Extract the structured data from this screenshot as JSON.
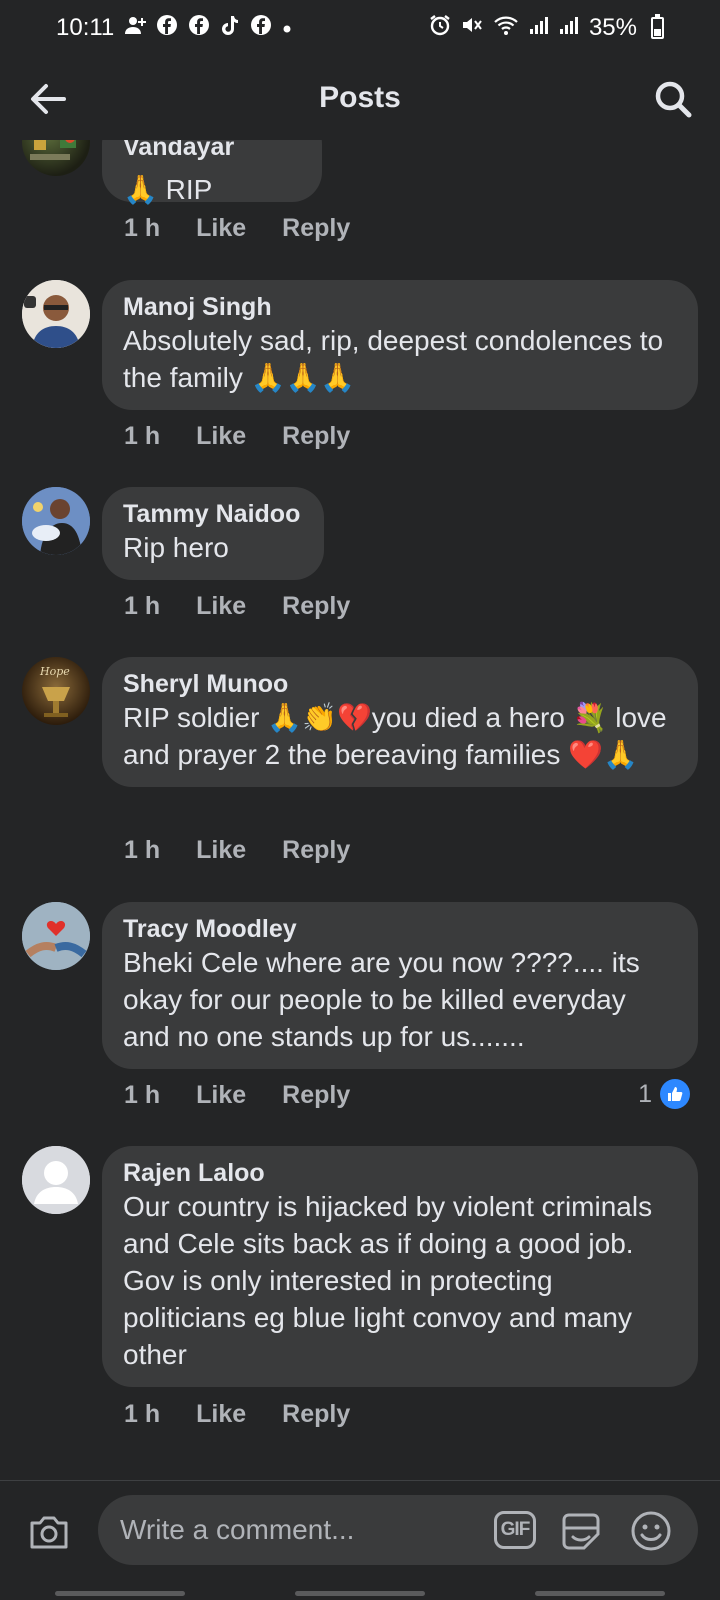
{
  "status_bar": {
    "time": "10:11",
    "notification_icons": [
      "person-add-icon",
      "facebook-icon",
      "facebook-icon",
      "tiktok-icon",
      "facebook-icon",
      "dot-icon"
    ],
    "system_icons": [
      "alarm-icon",
      "mute-icon",
      "wifi-icon",
      "signal-icon",
      "signal-icon"
    ],
    "battery": "35%"
  },
  "header": {
    "title": "Posts"
  },
  "comments": [
    {
      "author": "Dylan Vandayar",
      "text": "🙏 RIP",
      "time": "1 h",
      "like": "Like",
      "reply": "Reply"
    },
    {
      "author": "Manoj Singh",
      "text": "Absolutely sad, rip, deepest condolences to the family 🙏🙏🙏",
      "time": "1 h",
      "like": "Like",
      "reply": "Reply"
    },
    {
      "author": "Tammy Naidoo",
      "text": "Rip hero",
      "time": "1 h",
      "like": "Like",
      "reply": "Reply"
    },
    {
      "author": "Sheryl Munoo",
      "text": "RIP soldier  🙏👏💔you died a hero 💐 love and prayer 2 the bereaving families ❤️🙏",
      "time": "1 h",
      "like": "Like",
      "reply": "Reply"
    },
    {
      "author": "Tracy Moodley",
      "text": "Bheki Cele where are you now ????.... its okay for our people to be killed everyday and no one stands up for us.......",
      "time": "1 h",
      "like": "Like",
      "reply": "Reply",
      "reaction_count": "1"
    },
    {
      "author": "Rajen Laloo",
      "text": "Our country is hijacked by violent criminals and Cele sits back as if doing a good job. Gov is only interested in protecting politicians eg blue light convoy and many other",
      "time": "1 h",
      "like": "Like",
      "reply": "Reply"
    }
  ],
  "composer": {
    "placeholder": "Write a comment...",
    "gif_label": "GIF"
  },
  "colors": {
    "background": "#242526",
    "bubble": "#3a3b3c",
    "primary_text": "#e4e6eb",
    "secondary_text": "#b0b3b8",
    "like_blue": "#2d88ff"
  }
}
